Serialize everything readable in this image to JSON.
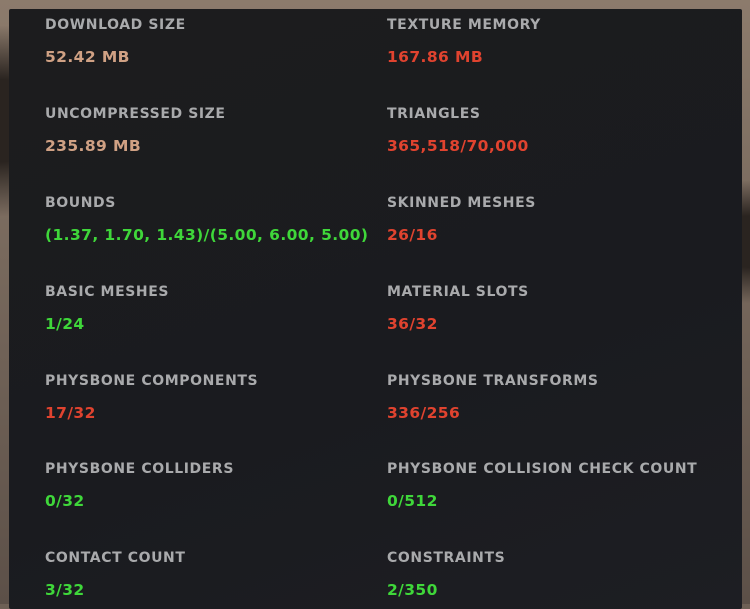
{
  "stats": [
    {
      "label": "DOWNLOAD SIZE",
      "value": "52.42 MB",
      "status": "neutral"
    },
    {
      "label": "TEXTURE MEMORY",
      "value": "167.86 MB",
      "status": "bad"
    },
    {
      "label": "UNCOMPRESSED SIZE",
      "value": "235.89 MB",
      "status": "neutral"
    },
    {
      "label": "TRIANGLES",
      "value": "365,518/70,000",
      "status": "bad"
    },
    {
      "label": "BOUNDS",
      "value": "(1.37, 1.70, 1.43)/(5.00, 6.00, 5.00)",
      "status": "ok"
    },
    {
      "label": "SKINNED MESHES",
      "value": "26/16",
      "status": "bad"
    },
    {
      "label": "BASIC MESHES",
      "value": "1/24",
      "status": "ok"
    },
    {
      "label": "MATERIAL SLOTS",
      "value": "36/32",
      "status": "bad"
    },
    {
      "label": "PHYSBONE COMPONENTS",
      "value": "17/32",
      "status": "bad"
    },
    {
      "label": "PHYSBONE TRANSFORMS",
      "value": "336/256",
      "status": "bad"
    },
    {
      "label": "PHYSBONE COLLIDERS",
      "value": "0/32",
      "status": "ok"
    },
    {
      "label": "PHYSBONE COLLISION CHECK COUNT",
      "value": "0/512",
      "status": "ok"
    },
    {
      "label": "CONTACT COUNT",
      "value": "3/32",
      "status": "ok"
    },
    {
      "label": "CONSTRAINTS",
      "value": "2/350",
      "status": "ok"
    }
  ],
  "colors": {
    "neutral": "#d0a184",
    "bad": "#e0432f",
    "ok": "#3fd73a",
    "label": "#a9aaac",
    "panel": "#1c1c1e"
  }
}
